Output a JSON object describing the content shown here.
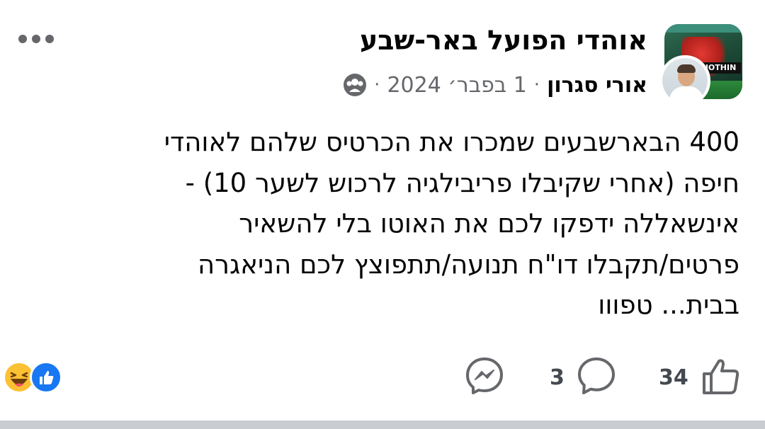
{
  "post": {
    "group_name": "אוהדי הפועל באר-שבע",
    "author": "אורי סגרון",
    "separator": "·",
    "date": "1 בפבר׳ 2024",
    "separator2": "·",
    "group_avatar_text": "NOTHIN",
    "text_lines": [
      "400 הבארשבעים שמכרו את הכרטיס שלהם לאוהדי",
      "חיפה (אחרי שקיבלו פריבילגיה לרכוש לשער 10) -",
      "אינשאללה ידפקו לכם את האוטו בלי להשאיר",
      "פרטים/תקבלו דו\"ח תנועה/תתפוצץ לכם הניאגרה",
      "בבית... טפווו"
    ]
  },
  "footer": {
    "like_count": "34",
    "comment_count": "3",
    "reactions": [
      "like",
      "haha"
    ]
  },
  "icons": {
    "more": "more-horizontal-icon",
    "audience": "group-audience-icon",
    "like": "thumbs-up-icon",
    "comment": "comment-bubble-icon",
    "share": "messenger-icon"
  },
  "colors": {
    "text": "#050505",
    "secondary": "#65676b",
    "like_blue": "#1877f2",
    "haha_yellow": "#fcc033"
  }
}
